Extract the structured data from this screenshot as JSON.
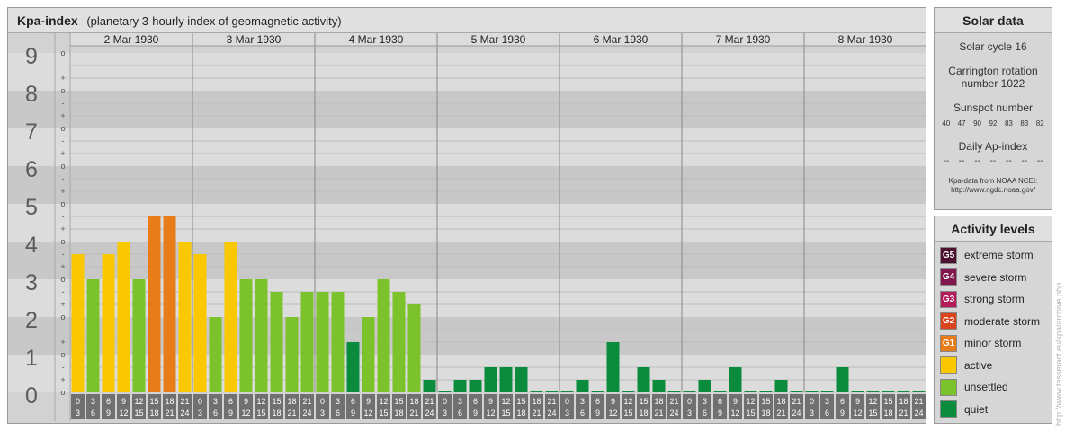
{
  "chart_data": {
    "type": "bar",
    "title": "Kpa-index",
    "subtitle": "(planetary 3-hourly index of geomagnetic activity)",
    "days": [
      "2 Mar 1930",
      "3 Mar 1930",
      "4 Mar 1930",
      "5 Mar 1930",
      "6 Mar 1930",
      "7 Mar 1930",
      "8 Mar 1930"
    ],
    "y_ticks": [
      "0",
      "1",
      "2",
      "3",
      "4",
      "5",
      "6",
      "7",
      "8",
      "9"
    ],
    "thirds_labels": [
      "o",
      "+",
      "-"
    ],
    "ylim": [
      0,
      9
    ],
    "interval_start": [
      "0",
      "3",
      "6",
      "9",
      "12",
      "15",
      "18",
      "21"
    ],
    "interval_end": [
      "3",
      "6",
      "9",
      "12",
      "15",
      "18",
      "21",
      "24"
    ],
    "values": [
      3.667,
      3.0,
      3.667,
      4.0,
      3.0,
      4.667,
      4.667,
      4.0,
      3.667,
      2.0,
      4.0,
      3.0,
      3.0,
      2.667,
      2.0,
      2.667,
      2.667,
      2.667,
      1.333,
      2.0,
      3.0,
      2.667,
      2.333,
      0.333,
      0.0,
      0.333,
      0.333,
      0.667,
      0.667,
      0.667,
      0.0,
      0.0,
      0.0,
      0.333,
      0.0,
      1.333,
      0.0,
      0.667,
      0.333,
      0.0,
      0.0,
      0.333,
      0.0,
      0.667,
      0.0,
      0.0,
      0.333,
      0.0,
      0.0,
      0.0,
      0.667,
      0.0,
      0.0,
      0.0,
      0.0,
      0.0
    ],
    "grid": true,
    "colors": {
      "quiet": "#0a8c3c",
      "unsettled": "#7cc22c",
      "active": "#fac800",
      "g1": "#e87c18",
      "g2": "#d9441c",
      "g3": "#b41c5c",
      "g4": "#80184c",
      "g5": "#4c1030",
      "band_dark": "#c8c8c8",
      "band_light": "#dcdcdc",
      "tick_box": "#707070"
    }
  },
  "solar": {
    "title": "Solar data",
    "cycle": "Solar cycle 16",
    "carrington_line1": "Carrington rotation",
    "carrington_line2": "number 1022",
    "sunspot_label": "Sunspot number",
    "sunspot_values": [
      "40",
      "47",
      "90",
      "92",
      "83",
      "83",
      "82"
    ],
    "ap_label": "Daily Ap-index",
    "ap_values": [
      "--",
      "--",
      "--",
      "--",
      "--",
      "--",
      "--"
    ],
    "source_line1": "Kpa-data from NOAA NCEI:",
    "source_line2": "http://www.ngdc.noaa.gov/"
  },
  "levels": {
    "title": "Activity levels",
    "items": [
      {
        "badge": "G5",
        "label": "extreme storm",
        "color": "#4c1030"
      },
      {
        "badge": "G4",
        "label": "severe storm",
        "color": "#80184c"
      },
      {
        "badge": "G3",
        "label": "strong storm",
        "color": "#b41c5c"
      },
      {
        "badge": "G2",
        "label": "moderate storm",
        "color": "#d9441c"
      },
      {
        "badge": "G1",
        "label": "minor storm",
        "color": "#e87c18"
      },
      {
        "badge": "",
        "label": "active",
        "color": "#fac800"
      },
      {
        "badge": "",
        "label": "unsettled",
        "color": "#7cc22c"
      },
      {
        "badge": "",
        "label": "quiet",
        "color": "#0a8c3c"
      }
    ]
  },
  "watermark": "http://www.tesseract.eu/kpa/archive.php"
}
